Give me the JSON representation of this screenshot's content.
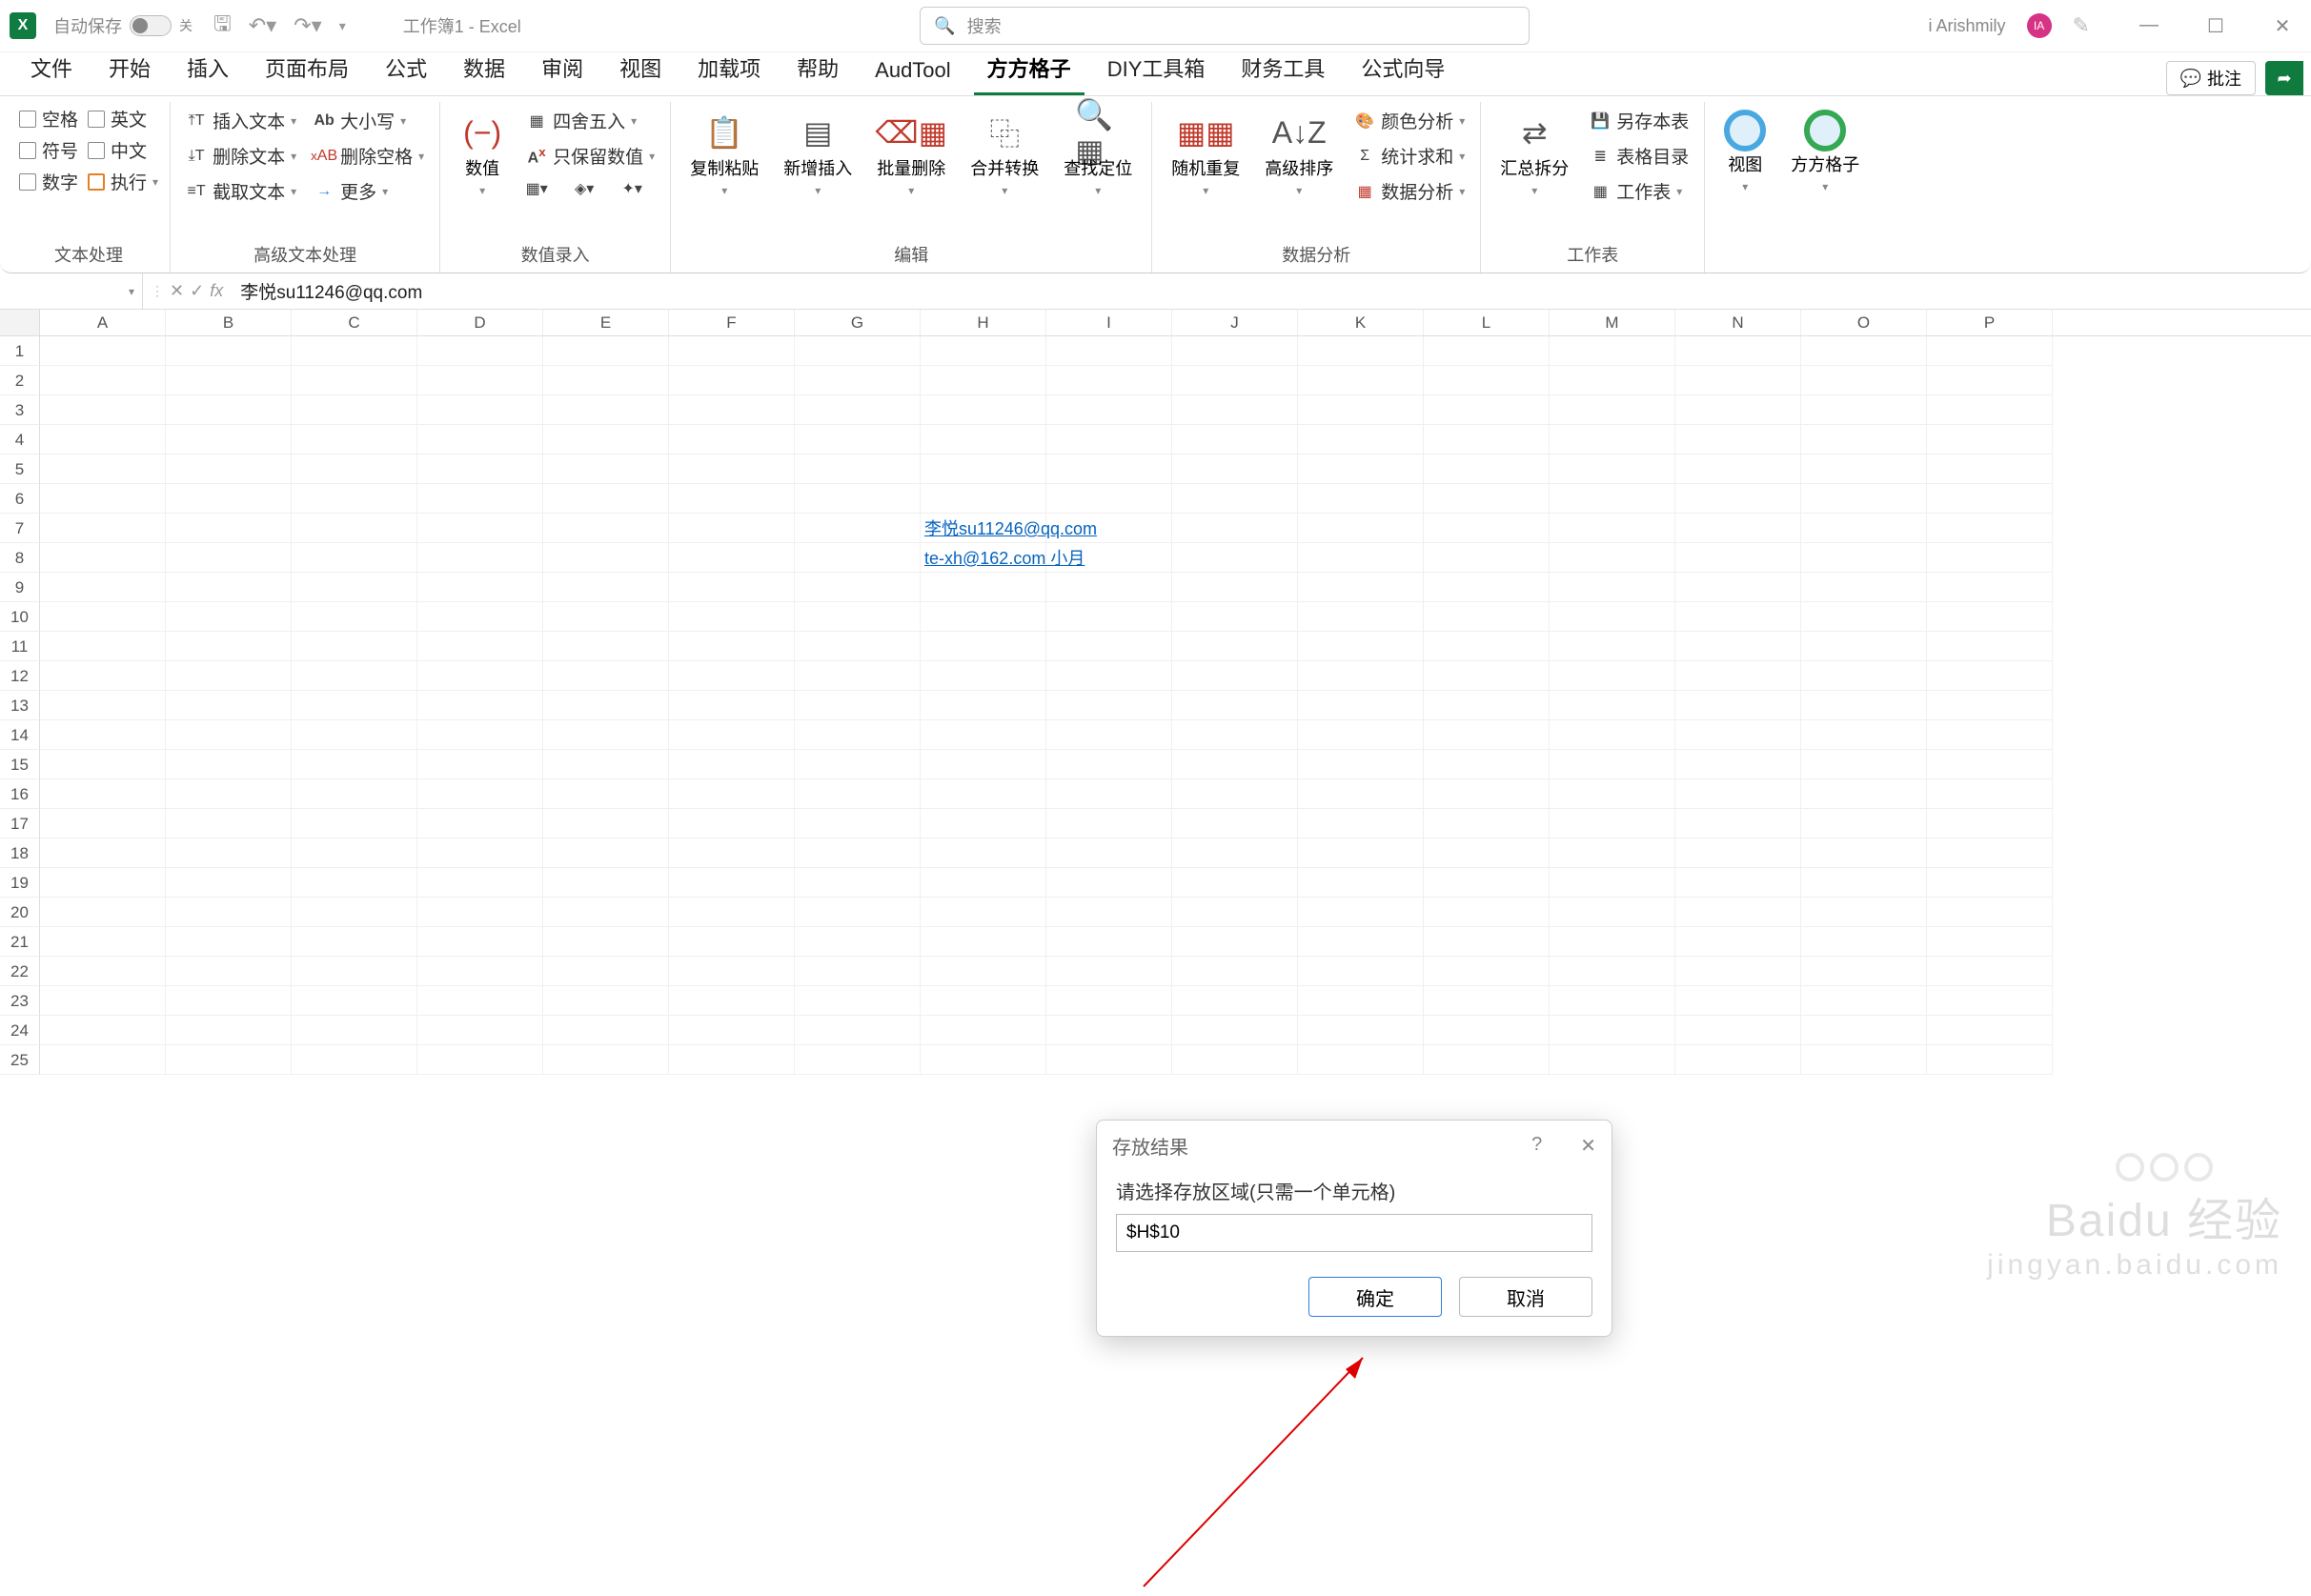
{
  "titlebar": {
    "autosave_label": "自动保存",
    "autosave_state": "关",
    "doc_title": "工作簿1 - Excel",
    "search_placeholder": "搜索",
    "username": "i Arishmily",
    "avatar_initials": "IA"
  },
  "tabs": [
    {
      "label": "文件"
    },
    {
      "label": "开始"
    },
    {
      "label": "插入"
    },
    {
      "label": "页面布局"
    },
    {
      "label": "公式"
    },
    {
      "label": "数据"
    },
    {
      "label": "审阅"
    },
    {
      "label": "视图"
    },
    {
      "label": "加载项"
    },
    {
      "label": "帮助"
    },
    {
      "label": "AudTool"
    },
    {
      "label": "方方格子",
      "active": true
    },
    {
      "label": "DIY工具箱"
    },
    {
      "label": "财务工具"
    },
    {
      "label": "公式向导"
    }
  ],
  "comment_label": "批注",
  "ribbon": {
    "g1": {
      "label": "文本处理",
      "col1": [
        "空格",
        "符号",
        "数字"
      ],
      "col2": [
        "英文",
        "中文",
        "执行"
      ]
    },
    "g2": {
      "label": "高级文本处理",
      "col1": [
        "插入文本",
        "删除文本",
        "截取文本"
      ],
      "col2": [
        "大小写",
        "删除空格",
        "更多"
      ]
    },
    "g3": {
      "label": "数值录入",
      "big": "数值",
      "col": [
        "四舍五入",
        "只保留数值"
      ]
    },
    "g4": {
      "label": "编辑",
      "btns": [
        "复制粘贴",
        "新增插入",
        "批量删除",
        "合并转换",
        "查找定位"
      ]
    },
    "g5": {
      "label": "数据分析",
      "btns": [
        "随机重复",
        "高级排序"
      ],
      "col": [
        "颜色分析",
        "统计求和",
        "数据分析"
      ]
    },
    "g6": {
      "label": "工作表",
      "big": "汇总拆分",
      "col": [
        "另存本表",
        "表格目录",
        "工作表"
      ]
    },
    "g7": {
      "view": "视图",
      "ffgz": "方方格子"
    }
  },
  "formula": {
    "cell_ref": "",
    "value": "李悦su11246@qq.com"
  },
  "columns": [
    "A",
    "B",
    "C",
    "D",
    "E",
    "F",
    "G",
    "H",
    "I",
    "J",
    "K",
    "L",
    "M",
    "N",
    "O",
    "P"
  ],
  "rows": 25,
  "cells": {
    "H7": "李悦su11246@qq.com",
    "H8": "te-xh@162.com 小月"
  },
  "dialog": {
    "title": "存放结果",
    "prompt": "请选择存放区域(只需一个单元格)",
    "value": "$H$10",
    "ok": "确定",
    "cancel": "取消"
  },
  "watermark": {
    "brand": "Baidu 经验",
    "url": "jingyan.baidu.com"
  }
}
